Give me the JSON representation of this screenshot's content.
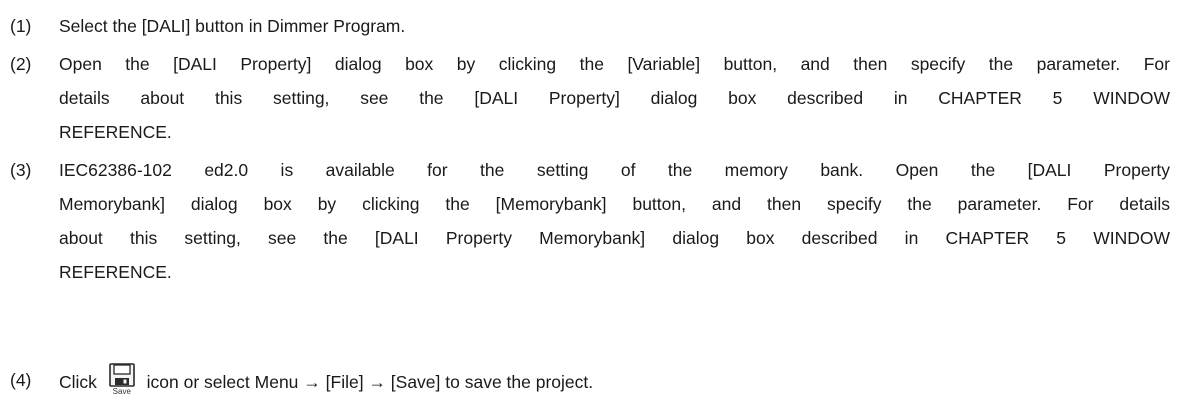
{
  "steps": [
    {
      "num": "(1)",
      "lines": [
        "Select the [DALI] button in Dimmer Program."
      ]
    },
    {
      "num": "(2)",
      "lines": [
        "Open the [DALI Property] dialog box by clicking the [Variable] button, and then specify the parameter. For",
        "details about this setting, see the [DALI Property] dialog box described in CHAPTER 5 WINDOW",
        "REFERENCE."
      ]
    },
    {
      "num": "(3)",
      "lines": [
        "IEC62386-102 ed2.0 is available for the setting of the memory bank. Open the [DALI Property",
        "Memorybank] dialog box by clicking the [Memorybank] button, and then specify the parameter. For details",
        "about this setting, see the [DALI Property Memorybank] dialog box described in CHAPTER 5 WINDOW",
        "REFERENCE."
      ]
    },
    {
      "num": "(4)",
      "before_icon": "Click",
      "after_icon": "icon or select Menu → [File] → [Save] to save the project.",
      "icon": {
        "name": "save-icon",
        "caption": "Save"
      }
    }
  ]
}
